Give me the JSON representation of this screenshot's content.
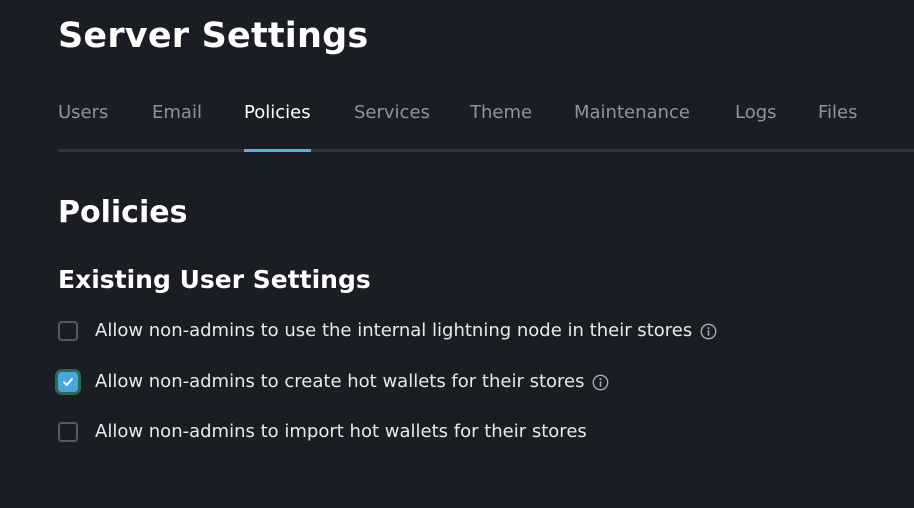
{
  "header": {
    "title": "Server Settings"
  },
  "tabs": [
    {
      "label": "Users",
      "active": false
    },
    {
      "label": "Email",
      "active": false
    },
    {
      "label": "Policies",
      "active": true
    },
    {
      "label": "Services",
      "active": false
    },
    {
      "label": "Theme",
      "active": false
    },
    {
      "label": "Maintenance",
      "active": false
    },
    {
      "label": "Logs",
      "active": false
    },
    {
      "label": "Files",
      "active": false
    }
  ],
  "main": {
    "section_title": "Policies",
    "subsection_title": "Existing User Settings",
    "options": [
      {
        "label": "Allow non-admins to use the internal lightning node in their stores",
        "checked": false,
        "has_info": true
      },
      {
        "label": "Allow non-admins to create hot wallets for their stores",
        "checked": true,
        "has_info": true
      },
      {
        "label": "Allow non-admins to import hot wallets for their stores",
        "checked": false,
        "has_info": false
      }
    ]
  },
  "colors": {
    "background": "#1b1d24",
    "accent": "#5ab0e0",
    "checkbox_checked": "#4ba6df",
    "muted_text": "#8e949e"
  },
  "icons": {
    "info": "info-circle-icon",
    "check": "checkmark-icon"
  }
}
